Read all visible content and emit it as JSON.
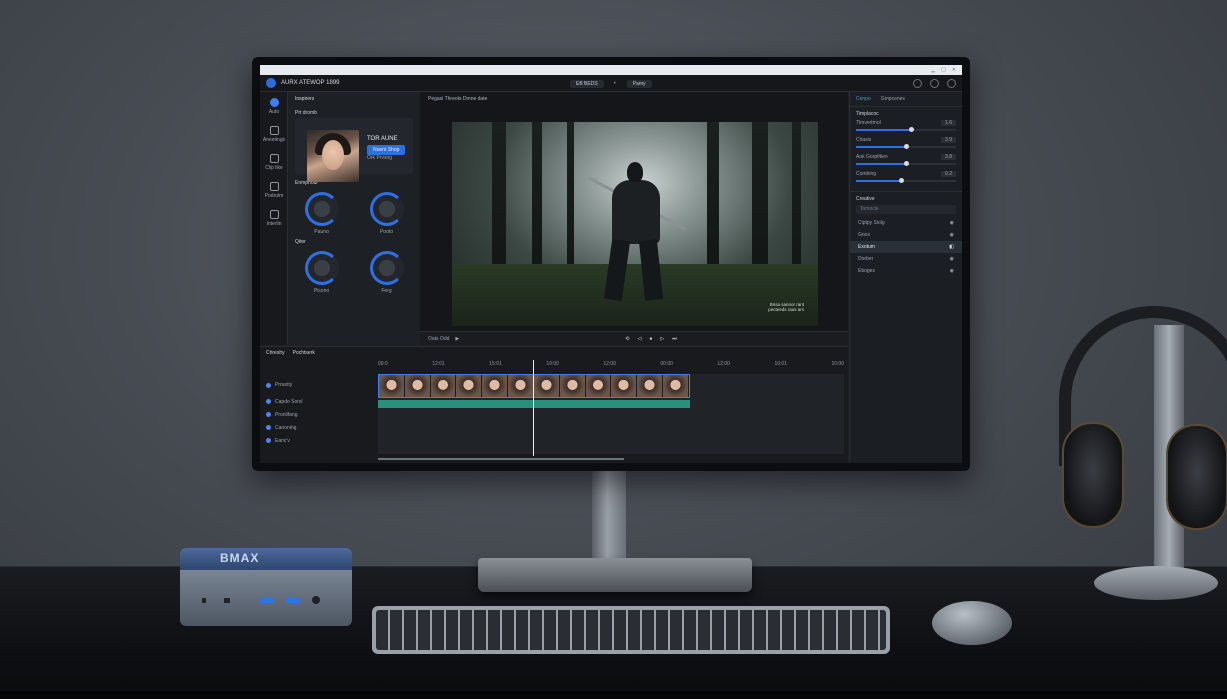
{
  "os_titlebar": {
    "text": ""
  },
  "app": {
    "title": "AURX ATEWOP 1899",
    "center_tabs": [
      "EB BEDS",
      "Pamy"
    ],
    "right_icons": [
      "help-icon",
      "notification-icon",
      "account-icon"
    ]
  },
  "left_nav": {
    "items": [
      {
        "label": "Auto",
        "icon": "media-icon"
      },
      {
        "label": "Aneetings",
        "icon": "grid-icon"
      },
      {
        "label": "Clip like",
        "icon": "effects-icon"
      },
      {
        "label": "Podroim",
        "icon": "audio-icon"
      },
      {
        "label": "Interlin",
        "icon": "export-icon"
      }
    ]
  },
  "assets_panel": {
    "header": "Inspirers",
    "card_title": "Prt dromb",
    "card_name": "TOR AUNE",
    "card_button": "Nuent Shop",
    "card_sub": "Ork Prvsng",
    "section1": "Enmphoul",
    "knobs1": [
      "Pauno",
      "Pooto"
    ],
    "section2": "Qiter",
    "knobs2": [
      "Pisono",
      "Ferg"
    ]
  },
  "viewer": {
    "title": "Pegasi Threots Dmne date",
    "overlay_text": [
      "Bnsa sannor rant",
      "pecteeds raus ars"
    ],
    "timecode": "Oats Odd",
    "transport_icons": [
      "loop-icon",
      "prev-icon",
      "play-icon",
      "next-icon",
      "end-icon"
    ]
  },
  "properties": {
    "tabs": [
      "Cenpo",
      "Gmpcenes"
    ],
    "section": "Timplacoc",
    "sliders": [
      {
        "label": "Tlmvertmol",
        "value": "1.6",
        "level": 0.55
      },
      {
        "label": "Chasis",
        "value": "3.9",
        "level": 0.5
      },
      {
        "label": "Auk Gorptltien",
        "value": "3.8",
        "level": 0.5
      },
      {
        "label": "Combing",
        "value": "0.2",
        "level": 0.45
      }
    ],
    "layers_title": "Creative",
    "search_placeholder": "Tomocle",
    "layers": [
      {
        "label": "Ciptpy Siolg",
        "selected": false
      },
      {
        "label": "Gnos",
        "selected": false
      },
      {
        "label": "Exotum",
        "selected": true
      },
      {
        "label": "Dorber",
        "selected": false
      },
      {
        "label": "Eboges",
        "selected": false
      }
    ]
  },
  "timeline": {
    "tabs": [
      "Chreshy",
      "Pochtserk"
    ],
    "ruler": [
      "00:0",
      "12:01",
      "15:01",
      "10:00",
      "12:00",
      "00:00",
      "12:00",
      "10:01",
      "10:00"
    ],
    "tracks": [
      "Prourity",
      "Capde Sorsl",
      "Pronlifang",
      "Canoning",
      "Eanc'v"
    ],
    "frame_count": 12
  },
  "hardware": {
    "minipc_brand": "BMAX"
  }
}
